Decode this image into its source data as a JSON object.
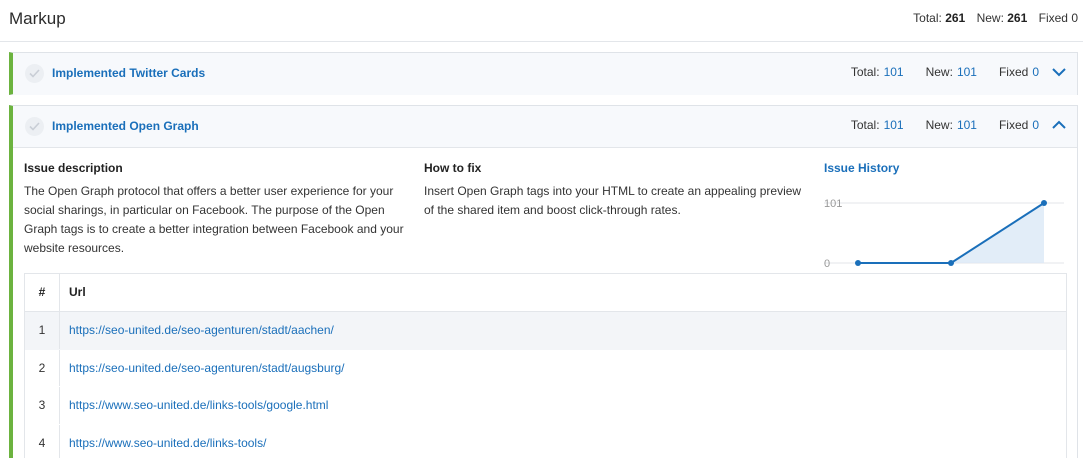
{
  "header": {
    "title": "Markup",
    "total_label": "Total:",
    "total_value": "261",
    "new_label": "New:",
    "new_value": "261",
    "fixed_label": "Fixed",
    "fixed_value": "0"
  },
  "panels": [
    {
      "title": "Implemented Twitter Cards",
      "total_label": "Total:",
      "total_value": "101",
      "new_label": "New:",
      "new_value": "101",
      "fixed_label": "Fixed",
      "fixed_value": "0",
      "state": "collapsed",
      "chevron_icon": "chevron-down-icon"
    },
    {
      "title": "Implemented Open Graph",
      "total_label": "Total:",
      "total_value": "101",
      "new_label": "New:",
      "new_value": "101",
      "fixed_label": "Fixed",
      "fixed_value": "0",
      "state": "expanded",
      "chevron_icon": "chevron-up-icon",
      "issue_description": {
        "heading": "Issue description",
        "text": "The Open Graph protocol that offers a better user experience for your social sharings, in particular on Facebook. The purpose of the Open Graph tags is to create a better integration between Facebook and your website resources."
      },
      "how_to_fix": {
        "heading": "How to fix",
        "text": "Insert Open Graph tags into your HTML to create an appealing preview of the shared item and boost click-through rates."
      },
      "issue_history": {
        "heading": "Issue History"
      },
      "table": {
        "columns": [
          "#",
          "Url"
        ],
        "rows": [
          {
            "num": "1",
            "url": "https://seo-united.de/seo-agenturen/stadt/aachen/"
          },
          {
            "num": "2",
            "url": "https://seo-united.de/seo-agenturen/stadt/augsburg/"
          },
          {
            "num": "3",
            "url": "https://www.seo-united.de/links-tools/google.html"
          },
          {
            "num": "4",
            "url": "https://www.seo-united.de/links-tools/"
          }
        ]
      }
    }
  ],
  "chart_data": {
    "type": "area",
    "title": "",
    "x": [
      1,
      2,
      3
    ],
    "series": [
      {
        "values": [
          0,
          0,
          101
        ]
      }
    ],
    "yticks": [
      "0",
      "101"
    ],
    "ylim": [
      0,
      101
    ],
    "grid": true,
    "colors": {
      "line": "#1a6fba",
      "fill": "#dbe8f6"
    }
  },
  "colors": {
    "accent": "#1a6fba",
    "status_bar": "#6cb33f",
    "panel_header_bg": "#f7f9fc"
  }
}
